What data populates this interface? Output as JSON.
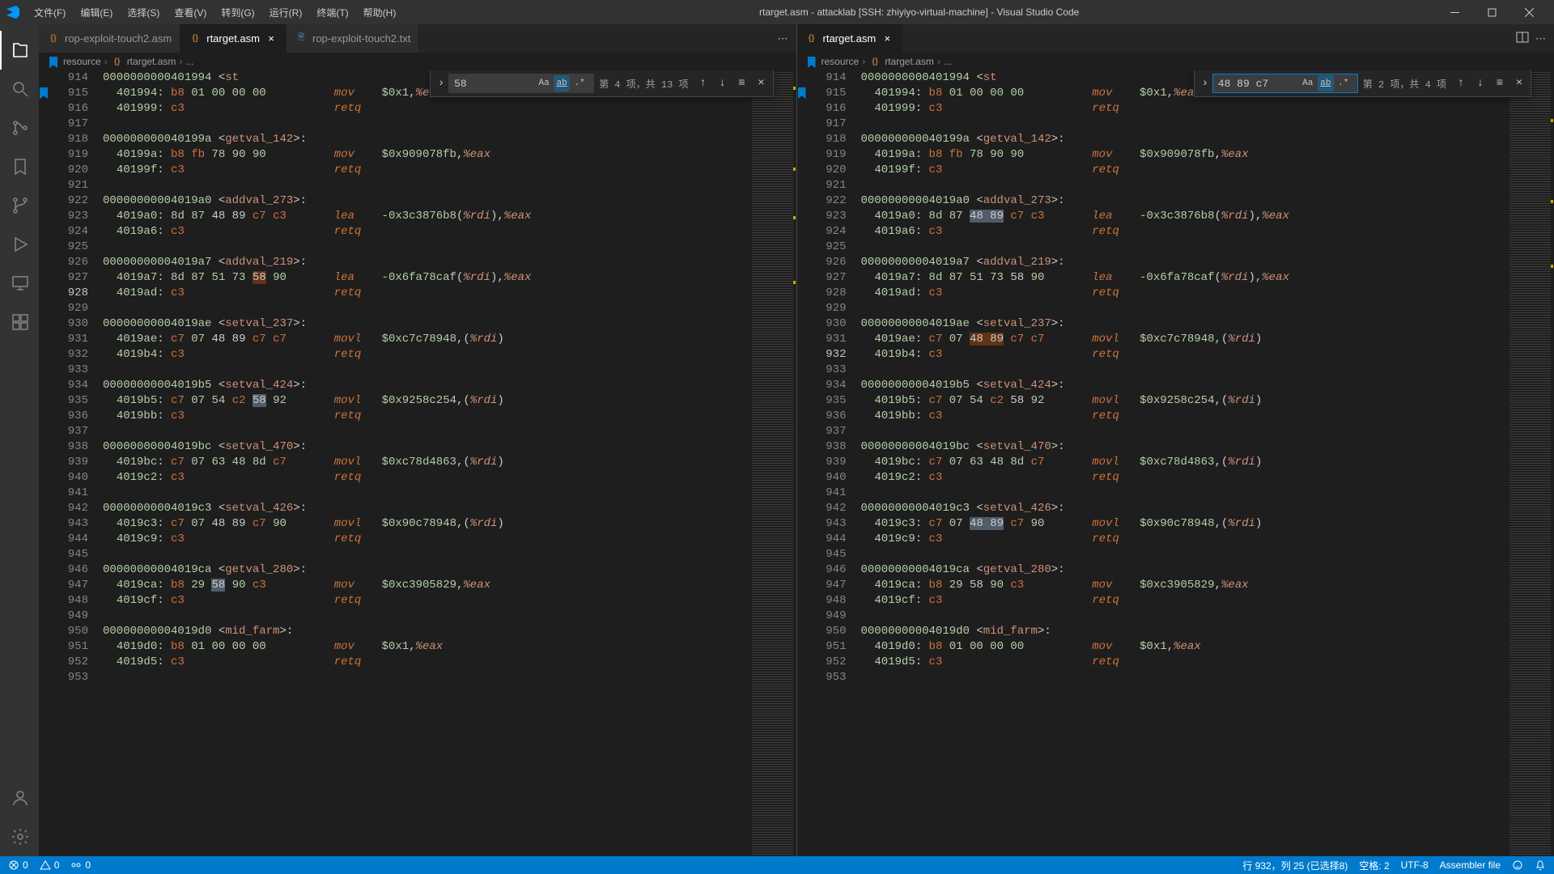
{
  "title": "rtarget.asm - attacklab [SSH: zhiyiyo-virtual-machine] - Visual Studio Code",
  "menu": [
    "文件(F)",
    "编辑(E)",
    "选择(S)",
    "查看(V)",
    "转到(G)",
    "运行(R)",
    "终端(T)",
    "帮助(H)"
  ],
  "tabs_left": [
    {
      "label": "rop-exploit-touch2.asm",
      "active": false,
      "type": "asm"
    },
    {
      "label": "rtarget.asm",
      "active": true,
      "type": "asm"
    },
    {
      "label": "rop-exploit-touch2.txt",
      "active": false,
      "type": "txt"
    }
  ],
  "tabs_right": [
    {
      "label": "rtarget.asm",
      "active": true,
      "type": "asm"
    }
  ],
  "breadcrumb": {
    "folder": "resource",
    "file": "rtarget.asm",
    "more": "..."
  },
  "find_left": {
    "query": "58",
    "count": "第 4 项，共 13 项",
    "whole_word": true
  },
  "find_right": {
    "query": "48 89 c7",
    "count": "第 2 项，共 4 项",
    "whole_word": true
  },
  "lines_start": 914,
  "status": {
    "errors": "0",
    "warnings": "0",
    "port": "0",
    "cursor": "行 932，列 25 (已选择8)",
    "spaces": "空格: 2",
    "enc": "UTF-8",
    "lang": "Assembler file"
  }
}
